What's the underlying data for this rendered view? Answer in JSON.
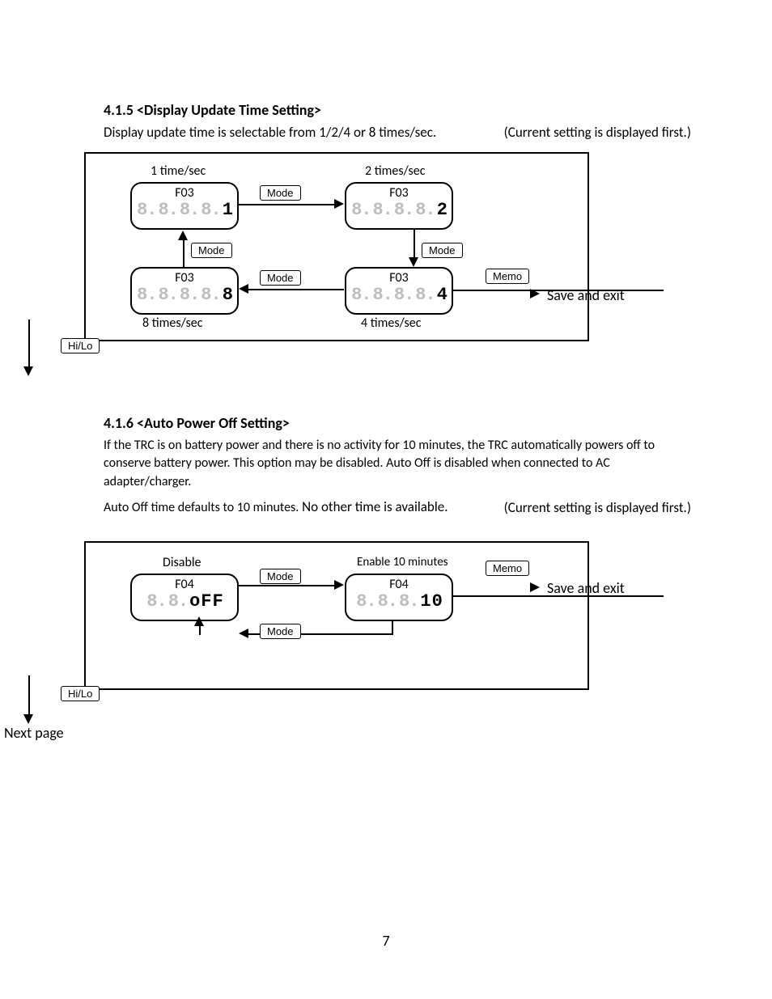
{
  "section1": {
    "heading": "4.1.5 <Display Update Time Setting>",
    "desc": "Display update time is selectable from 1/2/4 or 8 times/sec.",
    "currentNote": "(Current setting is displayed first.)",
    "captions": {
      "tl": "1 time/sec",
      "tr": "2 times/sec",
      "bl": "8 times/sec",
      "br": "4 times/sec"
    },
    "fcode": "F03",
    "values": {
      "tl": "1",
      "tr": "2",
      "bl": "8",
      "br": "4"
    },
    "buttons": {
      "mode": "Mode",
      "memo": "Memo",
      "hilo": "Hi/Lo"
    },
    "saveExit": "Save and exit"
  },
  "section2": {
    "heading": "4.1.6 <Auto Power Off Setting>",
    "para1": "If the TRC is on battery power and there is no activity for 10 minutes, the TRC automatically powers off to conserve battery power. This option may be disabled. Auto Off is disabled when connected to AC adapter/charger.",
    "para2_a": "Auto Off time defaults to 10 minutes.",
    "para2_b": " No other time is available.",
    "currentNote": "(Current setting is displayed first.)",
    "captions": {
      "left": "Disable",
      "right": "Enable 10 minutes"
    },
    "fcode": "F04",
    "values": {
      "left": "oFF",
      "right": "10"
    },
    "buttons": {
      "mode": "Mode",
      "memo": "Memo",
      "hilo": "Hi/Lo"
    },
    "saveExit": "Save and exit",
    "nextPage": "Next page"
  },
  "pageNumber": "7"
}
